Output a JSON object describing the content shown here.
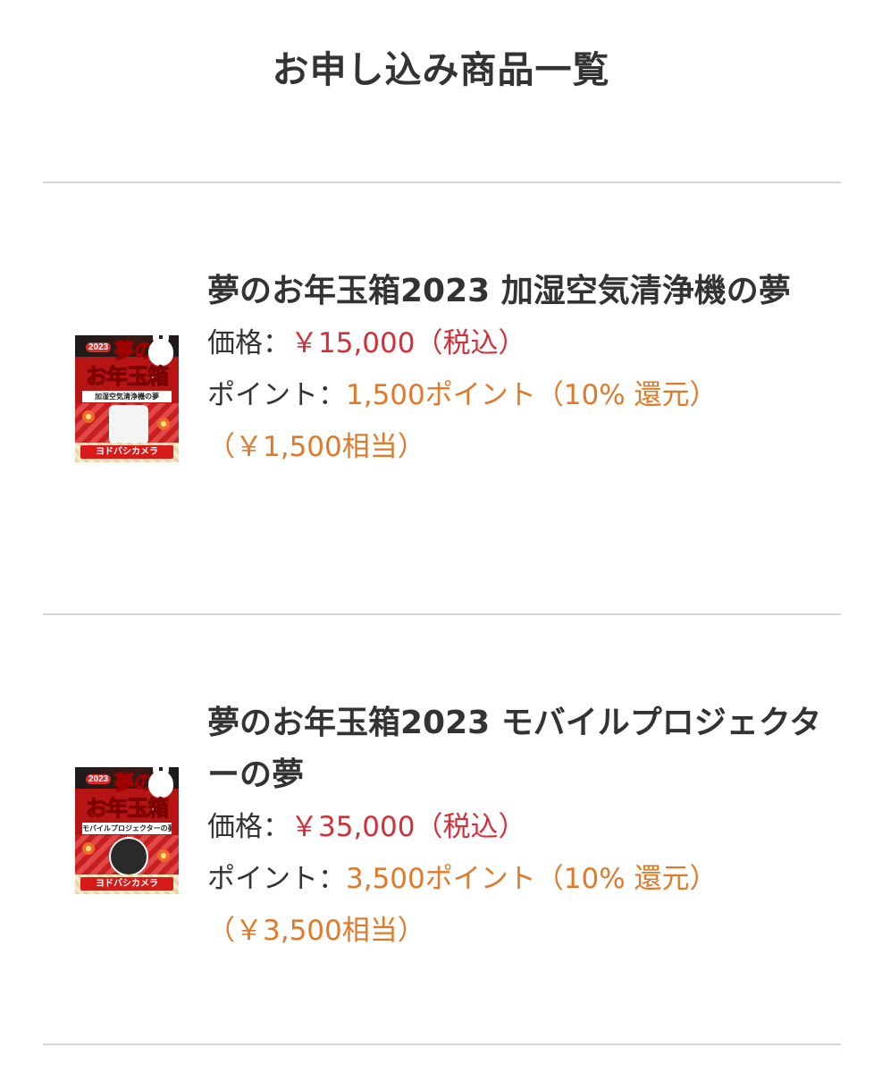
{
  "page": {
    "title": "お申し込み商品一覧"
  },
  "products": [
    {
      "name": "夢のお年玉箱2023 加湿空気清浄機の夢",
      "price_label": "価格：",
      "price": "￥15,000（税込）",
      "points_label": "ポイント：",
      "points": "1,500ポイント（10% 還元）",
      "points_yen": "（￥1,500相当）",
      "thumb": {
        "year": "2023",
        "yume": "夢の",
        "otoshidama": "お年玉箱",
        "band": "加湿空気清浄機の夢",
        "brand": "ヨドバシカメラ"
      }
    },
    {
      "name": "夢のお年玉箱2023 モバイルプロジェクターの夢",
      "price_label": "価格：",
      "price": "￥35,000（税込）",
      "points_label": "ポイント：",
      "points": "3,500ポイント（10% 還元）",
      "points_yen": "（￥3,500相当）",
      "thumb": {
        "year": "2023",
        "yume": "夢の",
        "otoshidama": "お年玉箱",
        "band": "モバイルプロジェクターの夢",
        "brand": "ヨドバシカメラ"
      }
    }
  ],
  "colors": {
    "text": "#333333",
    "price": "#d32f3a",
    "points": "#e07a2a",
    "divider": "#d5d5d5"
  }
}
